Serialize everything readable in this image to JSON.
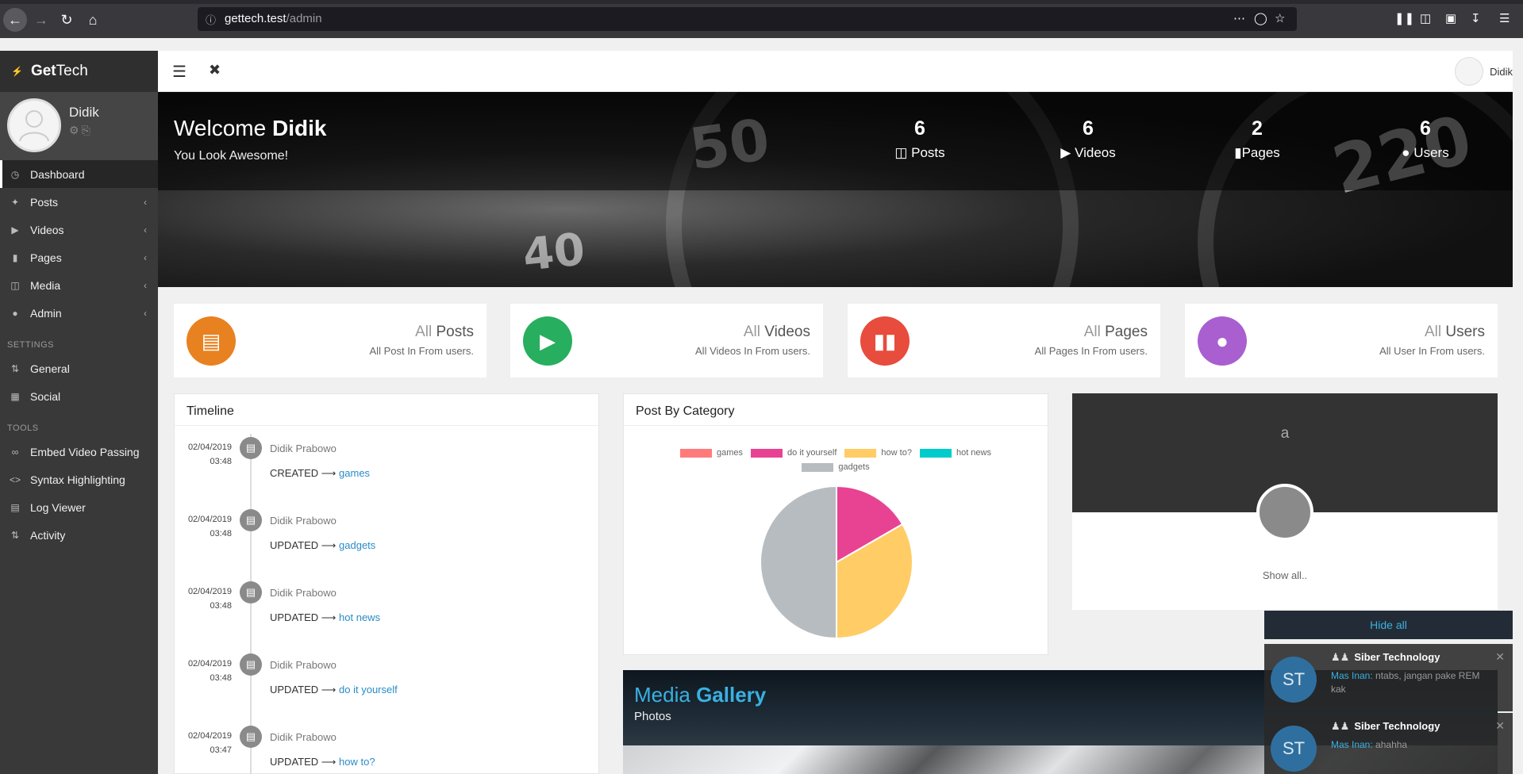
{
  "browser": {
    "url_host": "gettech.test",
    "url_path": "/admin"
  },
  "brand": {
    "bold": "Get",
    "rest": "Tech"
  },
  "user": {
    "name": "Didik"
  },
  "sidebar": {
    "items": [
      {
        "label": "Dashboard",
        "icon": "dashboard-icon"
      },
      {
        "label": "Posts",
        "icon": "pin-icon"
      },
      {
        "label": "Videos",
        "icon": "video-icon"
      },
      {
        "label": "Pages",
        "icon": "pages-icon"
      },
      {
        "label": "Media",
        "icon": "folder-icon"
      },
      {
        "label": "Admin",
        "icon": "user-icon"
      }
    ],
    "settings_header": "SETTINGS",
    "settings": [
      {
        "label": "General",
        "icon": "sliders-icon"
      },
      {
        "label": "Social",
        "icon": "grid-icon"
      }
    ],
    "tools_header": "TOOLS",
    "tools": [
      {
        "label": "Embed Video Passing",
        "icon": "link-icon"
      },
      {
        "label": "Syntax Highlighting",
        "icon": "code-icon"
      },
      {
        "label": "Log Viewer",
        "icon": "log-icon"
      },
      {
        "label": "Activity",
        "icon": "activity-icon"
      }
    ]
  },
  "topbar": {
    "username": "Didik"
  },
  "hero": {
    "welcome_prefix": "Welcome",
    "welcome_name": "Didik",
    "tagline": "You Look Awesome!",
    "stats": [
      {
        "value": "6",
        "label": "Posts"
      },
      {
        "value": "6",
        "label": "Videos"
      },
      {
        "value": "2",
        "label": "Pages"
      },
      {
        "value": "6",
        "label": "Users"
      }
    ]
  },
  "cards": [
    {
      "prefix": "All",
      "title": "Posts",
      "sub": "All Post In From users.",
      "color": "#e8811f"
    },
    {
      "prefix": "All",
      "title": "Videos",
      "sub": "All Videos In From users.",
      "color": "#27ae5f"
    },
    {
      "prefix": "All",
      "title": "Pages",
      "sub": "All Pages In From users.",
      "color": "#e74c3c"
    },
    {
      "prefix": "All",
      "title": "Users",
      "sub": "All User In From users.",
      "color": "#a95fcf"
    }
  ],
  "timeline": {
    "title": "Timeline",
    "items": [
      {
        "date": "02/04/2019",
        "time": "03:48",
        "who": "Didik Prabowo",
        "action": "CREATED",
        "target": "games"
      },
      {
        "date": "02/04/2019",
        "time": "03:48",
        "who": "Didik Prabowo",
        "action": "UPDATED",
        "target": "gadgets"
      },
      {
        "date": "02/04/2019",
        "time": "03:48",
        "who": "Didik Prabowo",
        "action": "UPDATED",
        "target": "hot news"
      },
      {
        "date": "02/04/2019",
        "time": "03:48",
        "who": "Didik Prabowo",
        "action": "UPDATED",
        "target": "do it yourself"
      },
      {
        "date": "02/04/2019",
        "time": "03:47",
        "who": "Didik Prabowo",
        "action": "UPDATED",
        "target": "how to?"
      }
    ]
  },
  "chart_panel": {
    "title": "Post By Category"
  },
  "chart_data": {
    "type": "pie",
    "title": "Post By Category",
    "categories": [
      "games",
      "do it yourself",
      "how to?",
      "hot news",
      "gadgets"
    ],
    "values": [
      0,
      1,
      2,
      0,
      3
    ],
    "colors": [
      "#ff7b7b",
      "#e84393",
      "#ffcc66",
      "#00cccc",
      "#b7bcc1"
    ],
    "legend": "top"
  },
  "profile": {
    "letter": "a",
    "show_all": "Show all.."
  },
  "gallery": {
    "title_a": "Media",
    "title_b": "Gallery",
    "subtitle": "Photos"
  },
  "notifications": {
    "hide_all": "Hide all",
    "items": [
      {
        "initials": "ST",
        "group": "Siber Technology",
        "sender": "Mas Inan:",
        "message": "ntabs, jangan pake REM kak"
      },
      {
        "initials": "ST",
        "group": "Siber Technology",
        "sender": "Mas Inan:",
        "message": "ahahha"
      }
    ]
  }
}
